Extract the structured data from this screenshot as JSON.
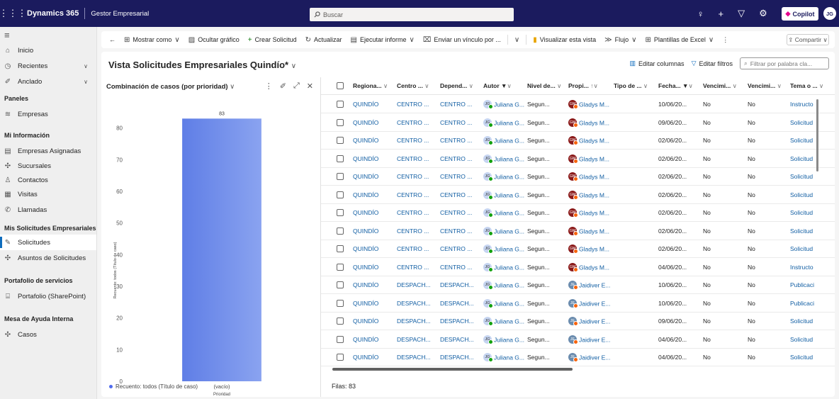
{
  "topbar": {
    "brand": "Dynamics 365",
    "app": "Gestor Empresarial",
    "search_placeholder": "Buscar",
    "copilot": "Copilot",
    "avatar": "JG"
  },
  "nav": {
    "items_top": [
      {
        "label": "Inicio",
        "icon": "home-icon"
      },
      {
        "label": "Recientes",
        "icon": "clock-icon"
      },
      {
        "label": "Anclado",
        "icon": "pin-icon"
      }
    ],
    "groups": [
      {
        "title": "Paneles",
        "items": [
          "Empresas"
        ]
      },
      {
        "title": "Mi Información",
        "items": [
          "Empresas Asignadas",
          "Sucursales",
          "Contactos",
          "Visitas",
          "Llamadas"
        ]
      },
      {
        "title": "Mis Solicitudes Empresariales",
        "items": [
          "Solicitudes",
          "Asuntos de Solicitudes"
        ]
      },
      {
        "title": "Portafolio de servicios",
        "items": [
          "Portafolio (SharePoint)"
        ]
      },
      {
        "title": "Mesa de Ayuda Interna",
        "items": [
          "Casos"
        ]
      }
    ]
  },
  "cmdbar": {
    "back": "←",
    "mostrar": "Mostrar como",
    "ocultar": "Ocultar gráfico",
    "crear": "Crear Solicitud",
    "actualizar": "Actualizar",
    "ejecutar": "Ejecutar informe",
    "enviar": "Enviar un vínculo por ...",
    "visualizar": "Visualizar esta vista",
    "flujo": "Flujo",
    "plantillas": "Plantillas de Excel",
    "compartir": "Compartir"
  },
  "view": {
    "title": "Vista Solicitudes Empresariales Quindío*",
    "editar_columnas": "Editar columnas",
    "editar_filtros": "Editar filtros",
    "filtro_placeholder": "Filtrar por palabra cla..."
  },
  "chart_data": {
    "type": "bar",
    "title": "Combinación de casos (por prioridad)",
    "categories": [
      "(vacío)"
    ],
    "values": [
      83
    ],
    "xlabel": "Prioridad",
    "ylabel": "Recuento: todos (Título de caso)",
    "ylim": [
      0,
      88
    ],
    "yticks": [
      0,
      10,
      20,
      30,
      40,
      50,
      60,
      70,
      80
    ],
    "legend": "Recuento: todos (Título de caso)",
    "data_label": "83",
    "color": "#6f8de8"
  },
  "grid": {
    "headers": [
      "Regiona...",
      "Centro ...",
      "Depend...",
      "Autor",
      "Nivel de...",
      "Propi...",
      "Tipo de ...",
      "Fecha...",
      "Vencimi...",
      "Vencimi...",
      "Tema o ..."
    ],
    "rows": [
      {
        "reg": "QUINDÍO",
        "centro": "CENTRO ...",
        "dep": "CENTRO ...",
        "autor": "Juliana G...",
        "nivel": "Segun...",
        "prop": "Gladys M...",
        "fecha": "10/06/20...",
        "v1": "No",
        "v2": "No",
        "tema": "Instructo"
      },
      {
        "reg": "QUINDÍO",
        "centro": "CENTRO ...",
        "dep": "CENTRO ...",
        "autor": "Juliana G...",
        "nivel": "Segun...",
        "prop": "Gladys M...",
        "fecha": "09/06/20...",
        "v1": "No",
        "v2": "No",
        "tema": "Solicitud"
      },
      {
        "reg": "QUINDÍO",
        "centro": "CENTRO ...",
        "dep": "CENTRO ...",
        "autor": "Juliana G...",
        "nivel": "Segun...",
        "prop": "Gladys M...",
        "fecha": "02/06/20...",
        "v1": "No",
        "v2": "No",
        "tema": "Solicitud"
      },
      {
        "reg": "QUINDÍO",
        "centro": "CENTRO ...",
        "dep": "CENTRO ...",
        "autor": "Juliana G...",
        "nivel": "Segun...",
        "prop": "Gladys M...",
        "fecha": "02/06/20...",
        "v1": "No",
        "v2": "No",
        "tema": "Solicitud"
      },
      {
        "reg": "QUINDÍO",
        "centro": "CENTRO ...",
        "dep": "CENTRO ...",
        "autor": "Juliana G...",
        "nivel": "Segun...",
        "prop": "Gladys M...",
        "fecha": "02/06/20...",
        "v1": "No",
        "v2": "No",
        "tema": "Solicitud"
      },
      {
        "reg": "QUINDÍO",
        "centro": "CENTRO ...",
        "dep": "CENTRO ...",
        "autor": "Juliana G...",
        "nivel": "Segun...",
        "prop": "Gladys M...",
        "fecha": "02/06/20...",
        "v1": "No",
        "v2": "No",
        "tema": "Solicitud"
      },
      {
        "reg": "QUINDÍO",
        "centro": "CENTRO ...",
        "dep": "CENTRO ...",
        "autor": "Juliana G...",
        "nivel": "Segun...",
        "prop": "Gladys M...",
        "fecha": "02/06/20...",
        "v1": "No",
        "v2": "No",
        "tema": "Solicitud"
      },
      {
        "reg": "QUINDÍO",
        "centro": "CENTRO ...",
        "dep": "CENTRO ...",
        "autor": "Juliana G...",
        "nivel": "Segun...",
        "prop": "Gladys M...",
        "fecha": "02/06/20...",
        "v1": "No",
        "v2": "No",
        "tema": "Solicitud"
      },
      {
        "reg": "QUINDÍO",
        "centro": "CENTRO ...",
        "dep": "CENTRO ...",
        "autor": "Juliana G...",
        "nivel": "Segun...",
        "prop": "Gladys M...",
        "fecha": "02/06/20...",
        "v1": "No",
        "v2": "No",
        "tema": "Solicitud"
      },
      {
        "reg": "QUINDÍO",
        "centro": "CENTRO ...",
        "dep": "CENTRO ...",
        "autor": "Juliana G...",
        "nivel": "Segun...",
        "prop": "Gladys M...",
        "fecha": "04/06/20...",
        "v1": "No",
        "v2": "No",
        "tema": "Instructo"
      },
      {
        "reg": "QUINDÍO",
        "centro": "DESPACH...",
        "dep": "DESPACH...",
        "autor": "Juliana G...",
        "nivel": "Segun...",
        "prop": "Jaidiver E...",
        "fecha": "10/06/20...",
        "v1": "No",
        "v2": "No",
        "tema": "Publicaci"
      },
      {
        "reg": "QUINDÍO",
        "centro": "DESPACH...",
        "dep": "DESPACH...",
        "autor": "Juliana G...",
        "nivel": "Segun...",
        "prop": "Jaidiver E...",
        "fecha": "10/06/20...",
        "v1": "No",
        "v2": "No",
        "tema": "Publicaci"
      },
      {
        "reg": "QUINDÍO",
        "centro": "DESPACH...",
        "dep": "DESPACH...",
        "autor": "Juliana G...",
        "nivel": "Segun...",
        "prop": "Jaidiver E...",
        "fecha": "09/06/20...",
        "v1": "No",
        "v2": "No",
        "tema": "Solicitud"
      },
      {
        "reg": "QUINDÍO",
        "centro": "DESPACH...",
        "dep": "DESPACH...",
        "autor": "Juliana G...",
        "nivel": "Segun...",
        "prop": "Jaidiver E...",
        "fecha": "04/06/20...",
        "v1": "No",
        "v2": "No",
        "tema": "Solicitud"
      },
      {
        "reg": "QUINDÍO",
        "centro": "DESPACH...",
        "dep": "DESPACH...",
        "autor": "Juliana G...",
        "nivel": "Segun...",
        "prop": "Jaidiver E...",
        "fecha": "04/06/20...",
        "v1": "No",
        "v2": "No",
        "tema": "Solicitud"
      }
    ],
    "footer": "Filas: 83"
  },
  "colors": {
    "topbar": "#1b1b5e",
    "link": "#115ea3",
    "bar": "#6f8de8",
    "gladys": "#8b1a1a",
    "jaidiver": "#6b8cae"
  }
}
